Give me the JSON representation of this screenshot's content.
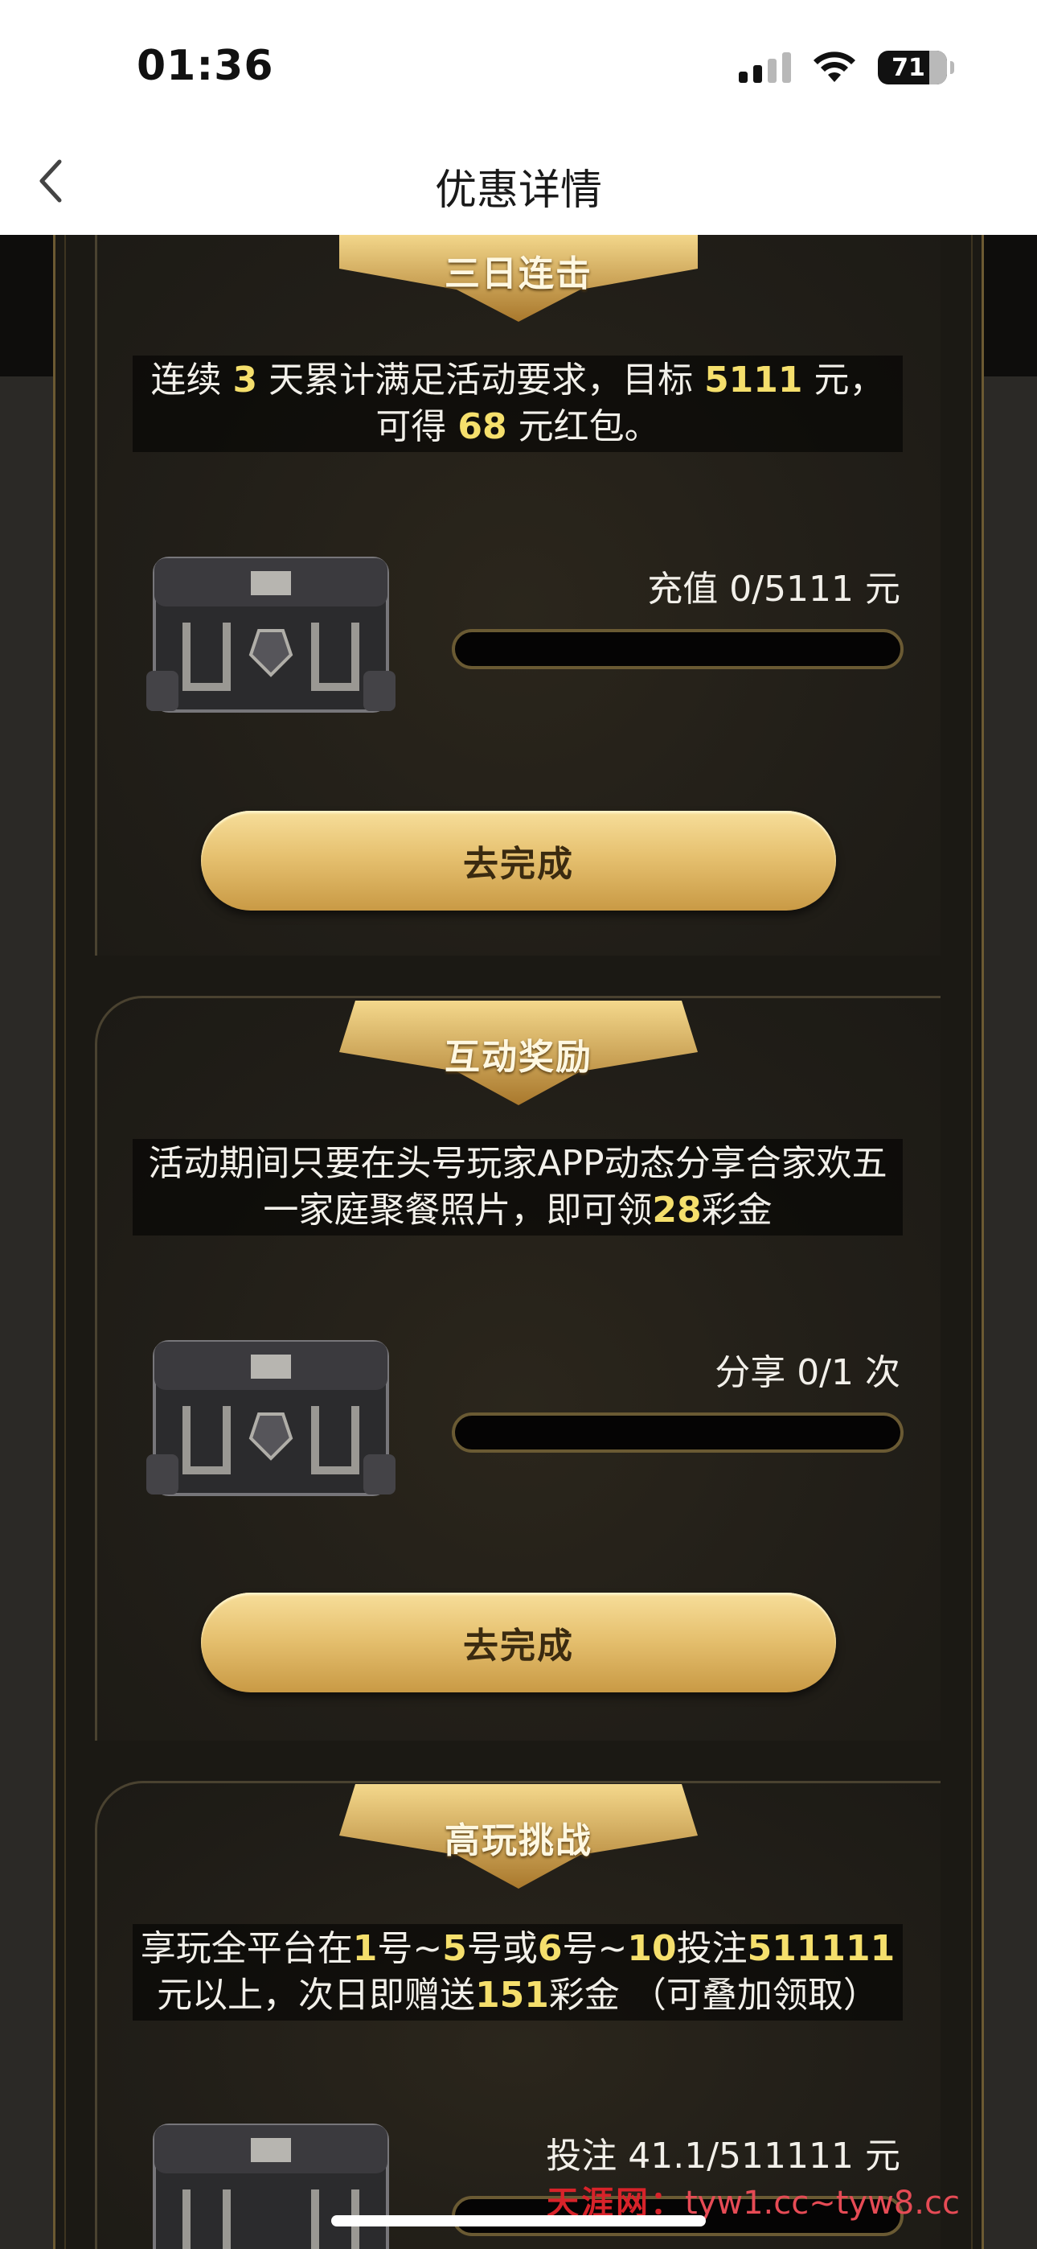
{
  "status_bar": {
    "time": "01:36",
    "battery": "71"
  },
  "nav": {
    "title": "优惠详情"
  },
  "cards": [
    {
      "title": "三日连击",
      "desc": [
        {
          "t": "连续 ",
          "hl": false
        },
        {
          "t": "3",
          "hl": true
        },
        {
          "t": " 天累计满足活动要求，目标 ",
          "hl": false
        },
        {
          "t": "5111",
          "hl": true
        },
        {
          "t": " 元，可得 ",
          "hl": false
        },
        {
          "t": "68",
          "hl": true
        },
        {
          "t": " 元红包。",
          "hl": false
        }
      ],
      "progress_label": "充值 0/5111 元",
      "progress": 0,
      "button": "去完成"
    },
    {
      "title": "互动奖励",
      "desc": [
        {
          "t": "活动期间只要在头号玩家APP动态分享合家欢五一家庭聚餐照片，即可领",
          "hl": false
        },
        {
          "t": "28",
          "hl": true
        },
        {
          "t": "彩金",
          "hl": false
        }
      ],
      "progress_label": "分享 0/1 次",
      "progress": 0,
      "button": "去完成"
    },
    {
      "title": "高玩挑战",
      "desc": [
        {
          "t": "享玩全平台在",
          "hl": false
        },
        {
          "t": "1",
          "hl": true
        },
        {
          "t": "号~",
          "hl": false
        },
        {
          "t": "5",
          "hl": true
        },
        {
          "t": "号或",
          "hl": false
        },
        {
          "t": "6",
          "hl": true
        },
        {
          "t": "号~",
          "hl": false
        },
        {
          "t": "10",
          "hl": true
        },
        {
          "t": "投注",
          "hl": false
        },
        {
          "t": "511111",
          "hl": true
        },
        {
          "t": "元以上，次日即赠送",
          "hl": false
        },
        {
          "t": "151",
          "hl": true
        },
        {
          "t": "彩金 （可叠加领取）",
          "hl": false
        }
      ],
      "progress_label": "投注 41.1/511111 元",
      "progress": 0.0001,
      "button": ""
    }
  ],
  "watermark": {
    "name": "天涯网：",
    "url": "tyw1.cc~tyw8.cc"
  }
}
